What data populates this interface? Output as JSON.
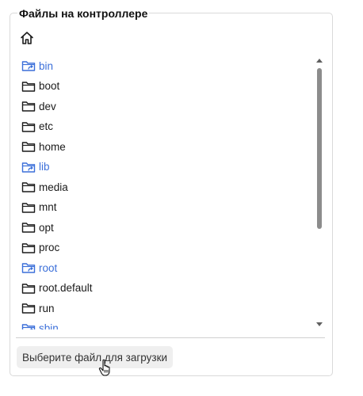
{
  "panel": {
    "title": "Файлы на контроллере"
  },
  "home": {
    "icon": "home-icon"
  },
  "files": [
    {
      "name": "bin",
      "type": "symlink-folder"
    },
    {
      "name": "boot",
      "type": "folder"
    },
    {
      "name": "dev",
      "type": "folder"
    },
    {
      "name": "etc",
      "type": "folder"
    },
    {
      "name": "home",
      "type": "folder"
    },
    {
      "name": "lib",
      "type": "symlink-folder"
    },
    {
      "name": "media",
      "type": "folder"
    },
    {
      "name": "mnt",
      "type": "folder"
    },
    {
      "name": "opt",
      "type": "folder"
    },
    {
      "name": "proc",
      "type": "folder"
    },
    {
      "name": "root",
      "type": "symlink-folder"
    },
    {
      "name": "root.default",
      "type": "folder"
    },
    {
      "name": "run",
      "type": "folder"
    },
    {
      "name": "sbin",
      "type": "symlink-folder"
    }
  ],
  "upload": {
    "label": "Выберите файл для загрузки"
  },
  "colors": {
    "link": "#3b6fd9",
    "text": "#1a1a1a",
    "border": "#d9d9d9",
    "button_bg": "#efefef"
  }
}
